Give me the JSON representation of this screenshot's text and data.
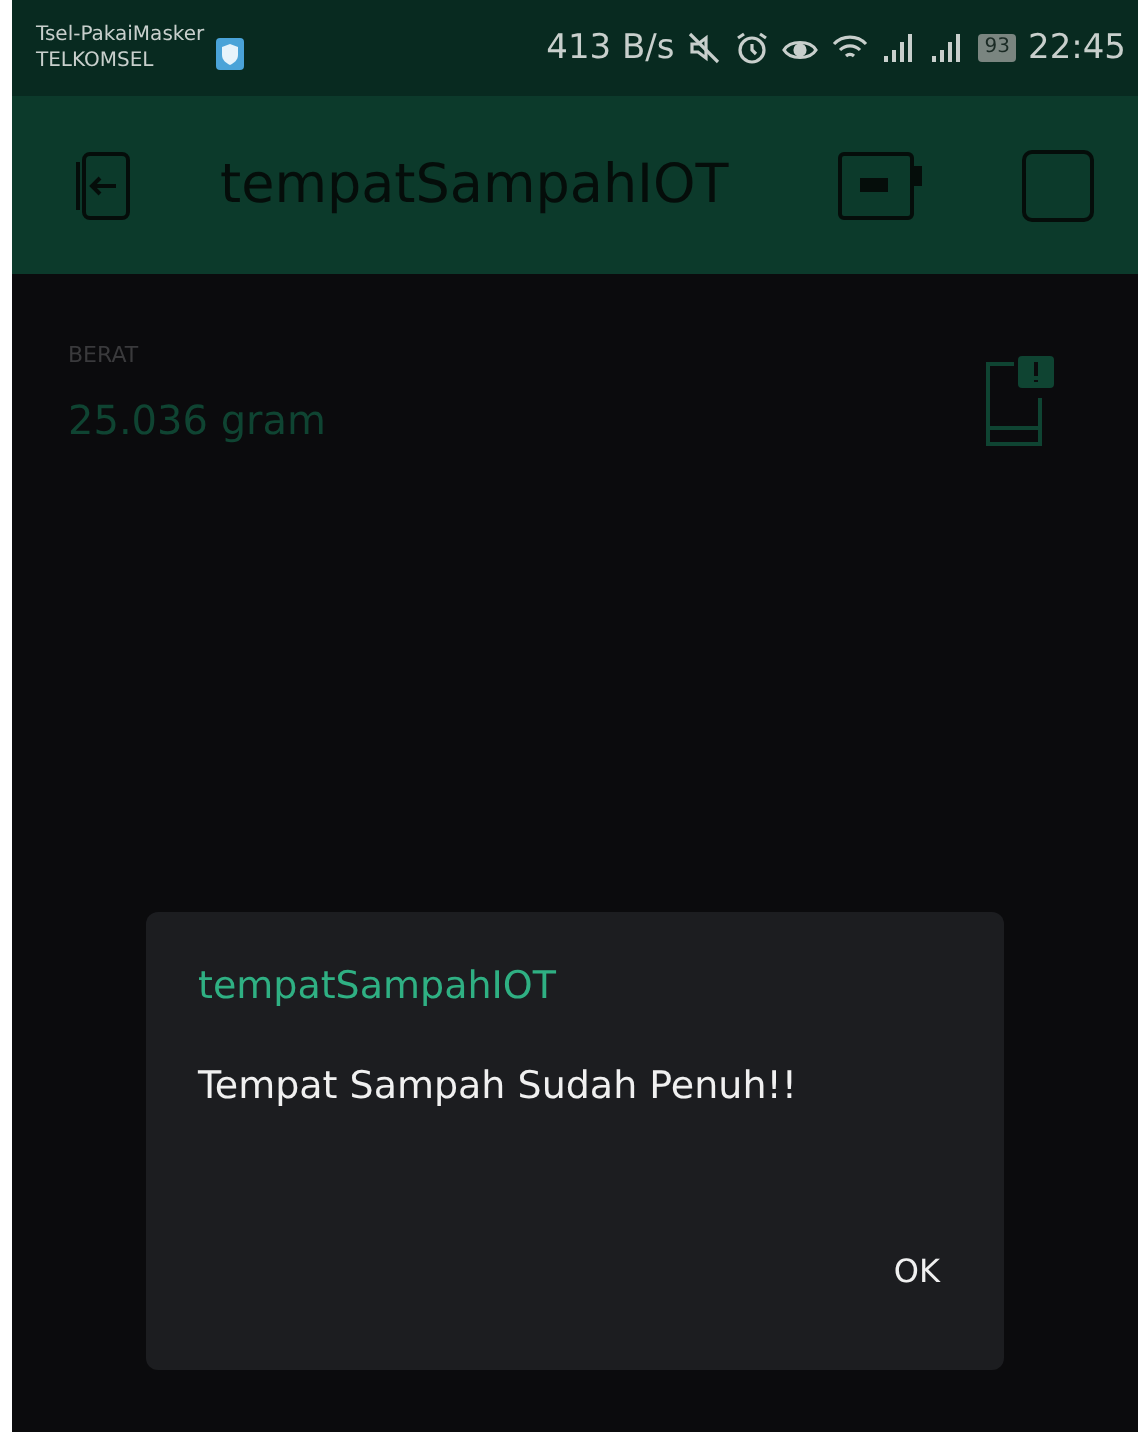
{
  "status_bar": {
    "carrier_1": "Tsel-PakaiMasker",
    "carrier_2": "TELKOMSEL",
    "speed": "413 B/s",
    "battery": "93",
    "time": "22:45"
  },
  "app_bar": {
    "title": "tempatSampahIOT"
  },
  "widget": {
    "label": "BERAT",
    "value": "25.036 gram"
  },
  "dialog": {
    "title": "tempatSampahIOT",
    "message": "Tempat Sampah Sudah Penuh!!",
    "button": "OK"
  }
}
